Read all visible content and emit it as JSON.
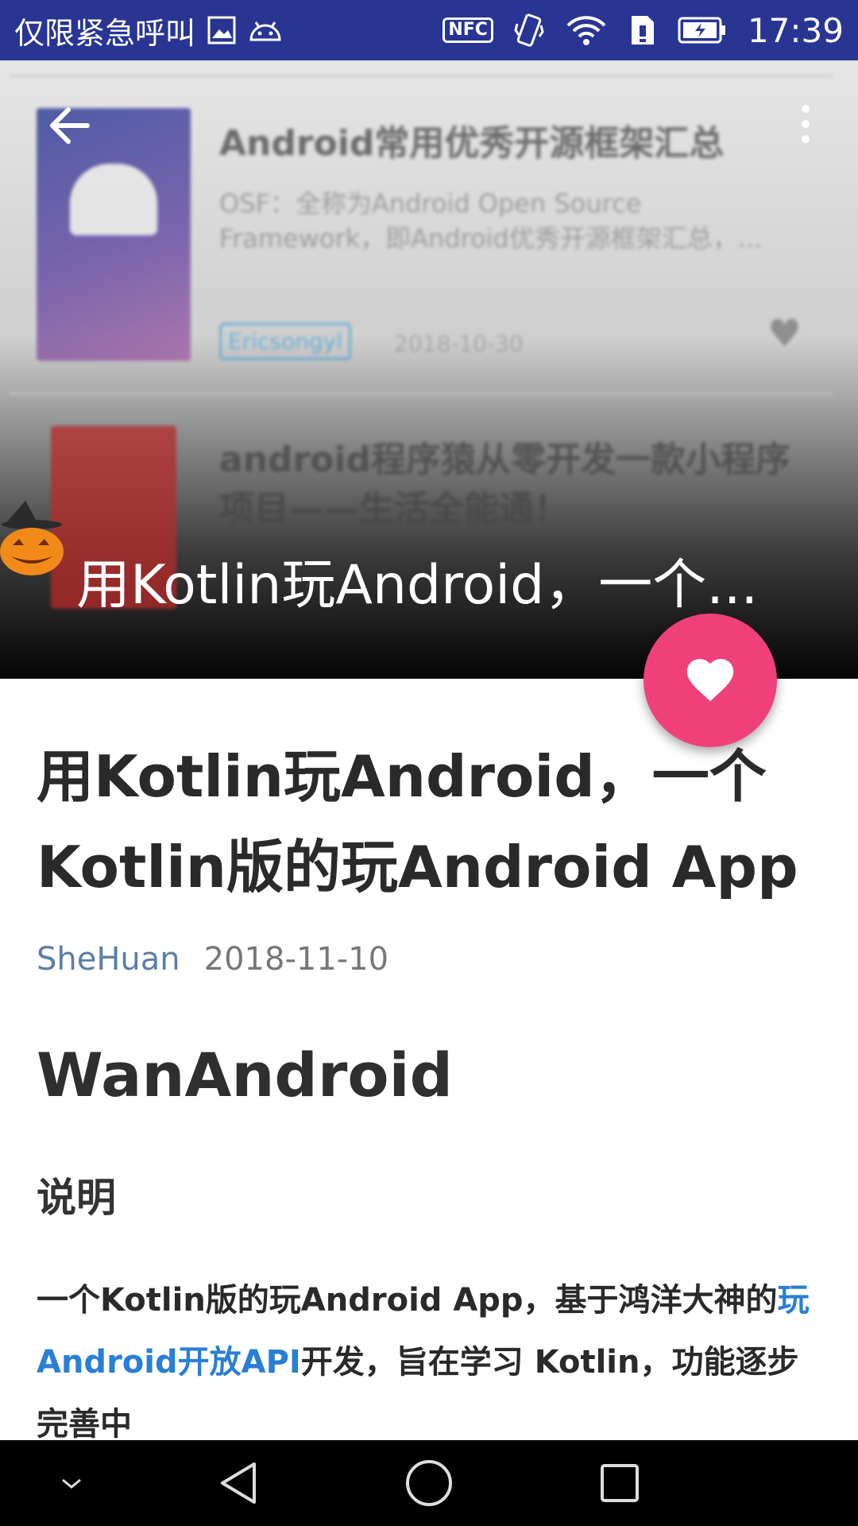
{
  "status_bar": {
    "carrier_text": "仅限紧急呼叫",
    "nfc_label": "NFC",
    "time": "17:39",
    "icons": [
      "gallery-icon",
      "android-icon",
      "nfc-icon",
      "vibrate-icon",
      "wifi-icon",
      "sim-icon",
      "battery-icon"
    ]
  },
  "background_list": {
    "items": [
      {
        "title": "Android常用优秀开源框架汇总",
        "desc_line1": "OSF：全称为Android Open Source",
        "desc_line2": "Framework，即Android优秀开源框架汇总，...",
        "tag": "Ericsongyl",
        "date": "2018-10-30"
      },
      {
        "title_line1": "android程序猿从零开发一款小程序",
        "title_line2": "项目——生活全能通！"
      }
    ]
  },
  "toolbar": {
    "collapsed_title": "用Kotlin玩Android，一个..."
  },
  "article": {
    "title": "用Kotlin玩Android，一个Kotlin版的玩Android App",
    "author": "SheHuan",
    "date": "2018-11-10",
    "heading": "WanAndroid",
    "subheading": "说明",
    "para_before_link": "一个Kotlin版的玩Android App，基于鸿洋大神的",
    "para_link": "玩Android开放API",
    "para_after_link": "开发，旨在学习 Kotlin，功能逐步完善中"
  },
  "colors": {
    "status_bar": "#283593",
    "fab": "#f0407a",
    "link": "#2a7fd4",
    "author": "#5a7fa8"
  }
}
